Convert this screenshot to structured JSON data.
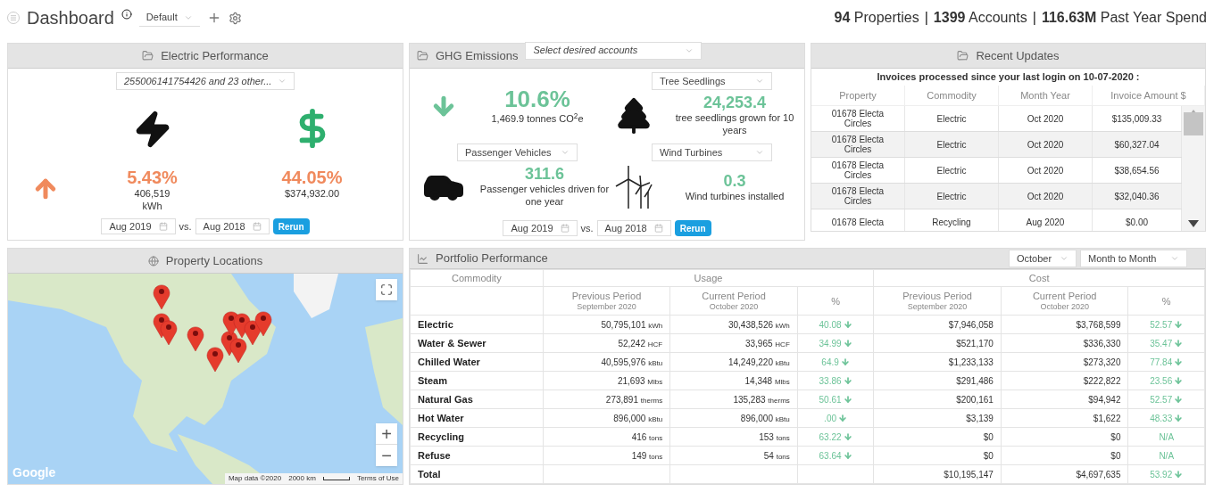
{
  "header": {
    "title": "Dashboard",
    "layout_select": "Default",
    "separators": [
      "|",
      "|"
    ],
    "summary": [
      "**94** Properties",
      "**1399** Accounts",
      "**116.63M** Past Year Spend"
    ]
  },
  "electric": {
    "title": "Electric Performance",
    "accounts": "255006141754426 and 23 other...",
    "increase": true,
    "usage_pct": "5.43%",
    "usage_value": "406,519",
    "usage_unit": "kWh",
    "cost_pct": "44.05%",
    "cost_value": "$374,932.00",
    "date_from": "Aug 2019",
    "vs": "vs.",
    "date_to": "Aug 2018",
    "rerun": "Rerun"
  },
  "ghg": {
    "title": "GHG Emissions",
    "accounts_placeholder": "Select desired accounts",
    "increase": false,
    "pct": "10.6%",
    "tonnes": "1,469.9 tonnes CO$^{2}$e",
    "equivalents": [
      {
        "kind": "tree",
        "select": "Tree Seedlings",
        "value": "24,253.4",
        "text": "tree seedlings grown for 10 years"
      },
      {
        "kind": "car",
        "select": "Passenger Vehicles",
        "value": "311.6",
        "text": "Passenger vehicles driven for one year"
      },
      {
        "kind": "turbine",
        "select": "Wind Turbines",
        "value": "0.3",
        "text": "Wind turbines installed"
      }
    ],
    "date_from": "Aug 2019",
    "vs": "vs.",
    "date_to": "Aug 2018",
    "rerun": "Rerun"
  },
  "recent": {
    "title": "Recent Updates",
    "caption": "Invoices processed since your last login on 10-07-2020 :",
    "columns": [
      "Property",
      "Commodity",
      "Month Year",
      "Invoice Amount $"
    ],
    "rows": [
      [
        "01678 Electa Circles",
        "Electric",
        "Oct 2020",
        "$135,009.33"
      ],
      [
        "01678 Electa Circles",
        "Electric",
        "Oct 2020",
        "$60,327.04"
      ],
      [
        "01678 Electa Circles",
        "Electric",
        "Oct 2020",
        "$38,654.56"
      ],
      [
        "01678 Electa Circles",
        "Electric",
        "Oct 2020",
        "$32,040.36"
      ],
      [
        "01678 Electa",
        "Recycling",
        "Aug 2020",
        "$0.00"
      ]
    ]
  },
  "map": {
    "title": "Property Locations",
    "logo": "Google",
    "attribution": "Map data ©2020",
    "scale": "2000 km",
    "terms": "Terms of Use",
    "zoom_in": "+",
    "zoom_out": "−"
  },
  "portfolio": {
    "title": "Portfolio Performance",
    "month": "October",
    "mode": "Month to Month",
    "col_commodity": "Commodity",
    "group_usage": "Usage",
    "group_cost": "Cost",
    "sub": [
      {
        "label": "Previous Period",
        "period": "September 2020"
      },
      {
        "label": "Current Period",
        "period": "October 2020"
      },
      {
        "label": "%"
      },
      {
        "label": "Previous Period",
        "period": "September 2020"
      },
      {
        "label": "Current Period",
        "period": "October 2020"
      },
      {
        "label": "%"
      }
    ],
    "rows": [
      {
        "name": "Electric",
        "prev": "50,795,101",
        "prev_unit": "kWh",
        "cur": "30,438,526",
        "cur_unit": "kWh",
        "usage_pct": "40.08",
        "usage_arrow": true,
        "cost_prev": "$7,946,058",
        "cost_cur": "$3,768,599",
        "cost_pct": "52.57",
        "cost_arrow": true
      },
      {
        "name": "Water & Sewer",
        "prev": "52,242",
        "prev_unit": "HCF",
        "cur": "33,965",
        "cur_unit": "HCF",
        "usage_pct": "34.99",
        "usage_arrow": true,
        "cost_prev": "$521,170",
        "cost_cur": "$336,330",
        "cost_pct": "35.47",
        "cost_arrow": true
      },
      {
        "name": "Chilled Water",
        "prev": "40,595,976",
        "prev_unit": "kBtu",
        "cur": "14,249,220",
        "cur_unit": "kBtu",
        "usage_pct": "64.9",
        "usage_arrow": true,
        "cost_prev": "$1,233,133",
        "cost_cur": "$273,320",
        "cost_pct": "77.84",
        "cost_arrow": true
      },
      {
        "name": "Steam",
        "prev": "21,693",
        "prev_unit": "Mlbs",
        "cur": "14,348",
        "cur_unit": "Mlbs",
        "usage_pct": "33.86",
        "usage_arrow": true,
        "cost_prev": "$291,486",
        "cost_cur": "$222,822",
        "cost_pct": "23.56",
        "cost_arrow": true
      },
      {
        "name": "Natural Gas",
        "prev": "273,891",
        "prev_unit": "therms",
        "cur": "135,283",
        "cur_unit": "therms",
        "usage_pct": "50.61",
        "usage_arrow": true,
        "cost_prev": "$200,161",
        "cost_cur": "$94,942",
        "cost_pct": "52.57",
        "cost_arrow": true
      },
      {
        "name": "Hot Water",
        "prev": "896,000",
        "prev_unit": "kBtu",
        "cur": "896,000",
        "cur_unit": "kBtu",
        "usage_pct": ".00",
        "usage_arrow": true,
        "cost_prev": "$3,139",
        "cost_cur": "$1,622",
        "cost_pct": "48.33",
        "cost_arrow": true
      },
      {
        "name": "Recycling",
        "prev": "416",
        "prev_unit": "tons",
        "cur": "153",
        "cur_unit": "tons",
        "usage_pct": "63.22",
        "usage_arrow": true,
        "cost_prev": "$0",
        "cost_cur": "$0",
        "cost_pct": "N/A",
        "cost_arrow": false
      },
      {
        "name": "Refuse",
        "prev": "149",
        "prev_unit": "tons",
        "cur": "54",
        "cur_unit": "tons",
        "usage_pct": "63.64",
        "usage_arrow": true,
        "cost_prev": "$0",
        "cost_cur": "$0",
        "cost_pct": "N/A",
        "cost_arrow": false
      },
      {
        "name": "Total",
        "cost_prev": "$10,195,147",
        "cost_cur": "$4,697,635",
        "cost_pct": "53.92",
        "cost_arrow": true
      }
    ]
  }
}
